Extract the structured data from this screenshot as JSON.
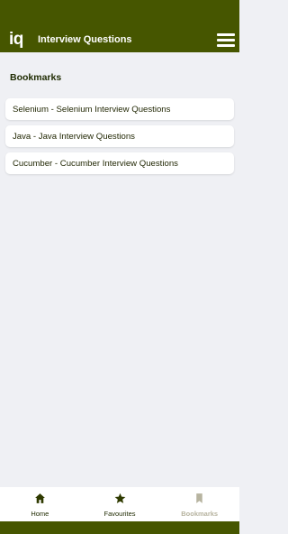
{
  "header": {
    "logo": "iq",
    "title": "Interview Questions",
    "menu_icon": "hamburger-menu-icon"
  },
  "section": {
    "title": "Bookmarks"
  },
  "bookmarks": [
    {
      "label": "Selenium - Selenium Interview Questions"
    },
    {
      "label": "Java - Java Interview Questions"
    },
    {
      "label": "Cucumber - Cucumber Interview Questions"
    }
  ],
  "bottom_nav": [
    {
      "label": "Home",
      "icon": "home-icon",
      "active": false
    },
    {
      "label": "Favourites",
      "icon": "star-icon",
      "active": false
    },
    {
      "label": "Bookmarks",
      "icon": "bookmark-icon",
      "active": true
    }
  ],
  "colors": {
    "primary": "#465600",
    "background": "#eff0f4",
    "inactive_tab": "#b7b4a0"
  }
}
